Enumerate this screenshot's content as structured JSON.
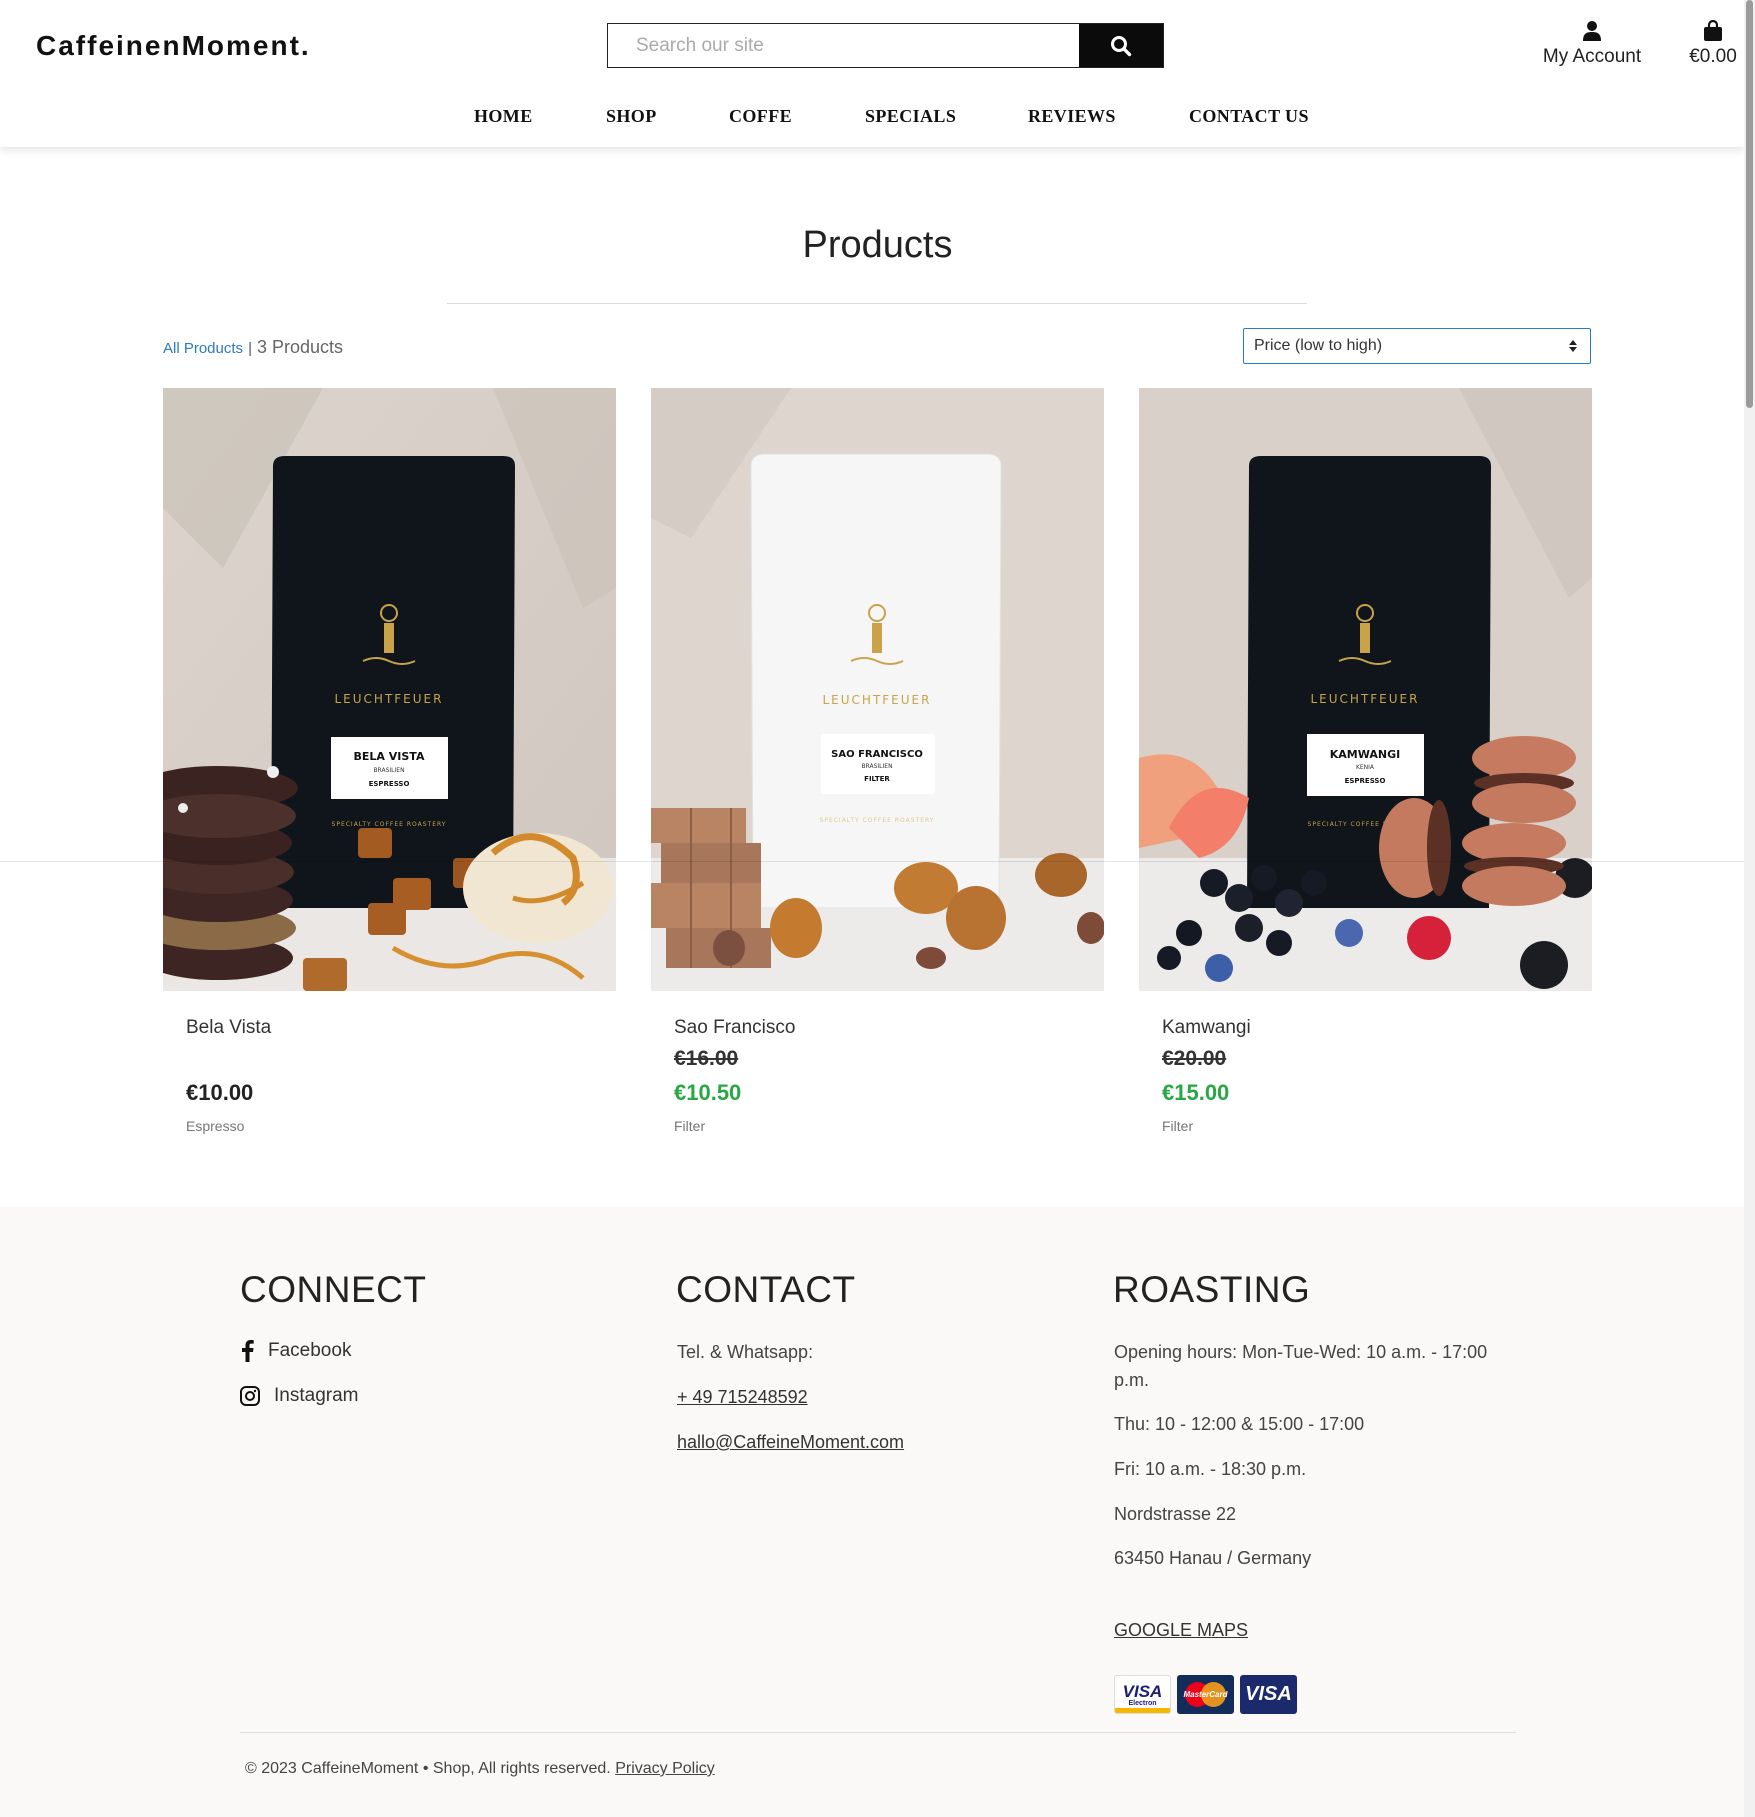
{
  "header": {
    "logo": "CaffeinenMoment.",
    "search_placeholder": "Search our site",
    "account_label": "My Account",
    "cart_total": "€0.00"
  },
  "nav": {
    "home": "HOME",
    "shop": "SHOP",
    "coffe": "COFFE",
    "specials": "SPECIALS",
    "reviews": "REVIEWS",
    "contact": "CONTACT US"
  },
  "main": {
    "title": "Products",
    "breadcrumb_all": "All Products",
    "breadcrumb_sep": "|",
    "product_count": "3 Products",
    "sort_selected": "Price (low to high)"
  },
  "products": [
    {
      "name": "Bela Vista",
      "price": "€10.00",
      "category": "Espresso",
      "bag_brand": "LEUCHTFEUER",
      "bag_label": "BELA VISTA",
      "bag_origin": "BRASILIEN",
      "bag_type": "ESPRESSO",
      "bag_tagline": "SPECIALTY COFFEE ROASTERY"
    },
    {
      "name": "Sao Francisco",
      "old_price": "€16.00",
      "price": "€10.50",
      "category": "Filter",
      "bag_brand": "LEUCHTFEUER",
      "bag_label": "SAO FRANCISCO",
      "bag_origin": "BRASILIEN",
      "bag_type": "FILTER",
      "bag_tagline": "SPECIALTY COFFEE ROASTERY"
    },
    {
      "name": "Kamwangi",
      "old_price": "€20.00",
      "price": "€15.00",
      "category": "Filter",
      "bag_brand": "LEUCHTFEUER",
      "bag_label": "KAMWANGI",
      "bag_origin": "KENIA",
      "bag_type": "ESPRESSO",
      "bag_tagline": "SPECIALTY COFFEE ROASTERY"
    }
  ],
  "footer": {
    "connect_title": "CONNECT",
    "facebook": "Facebook",
    "instagram": "Instagram",
    "contact_title": "CONTACT",
    "phone_label": "Tel. & Whatsapp:",
    "phone": "+ 49 715248592",
    "email": "hallo@CaffeineMoment.com",
    "roasting_title": "ROASTING",
    "hours_1": "Opening hours: Mon-Tue-Wed: 10 a.m. - 17:00 p.m.",
    "hours_2": "Thu: 10 - 12:00 & 15:00 - 17:00",
    "hours_3": "Fri: 10 a.m. - 18:30 p.m.",
    "street": "Nordstrasse 22",
    "city": "63450 Hanau / Germany",
    "maps_link": "GOOGLE MAPS",
    "payment_visa_electron": "VISA",
    "payment_visa_electron_sub": "Electron",
    "payment_mastercard": "MasterCard",
    "payment_visa": "VISA",
    "copyright": "© 2023 CaffeineMoment • Shop, All rights reserved.",
    "privacy": "Privacy Policy"
  },
  "colors": {
    "accent_link": "#2b7bc1",
    "sale_price": "#28a745",
    "footer_bg": "#faf9f7",
    "bag_dark": "#0f151b",
    "bag_gold": "#c9a24a"
  }
}
